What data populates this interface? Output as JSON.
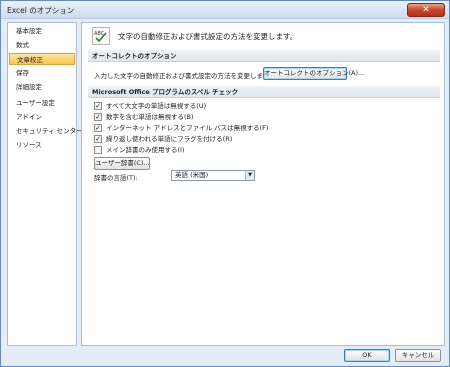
{
  "window": {
    "title": "Excel のオプション",
    "close_glyph": "✕"
  },
  "sidebar": {
    "items": [
      {
        "label": "基本設定",
        "active": false
      },
      {
        "label": "数式",
        "active": false
      },
      {
        "label": "文章校正",
        "active": true
      },
      {
        "label": "保存",
        "active": false
      },
      {
        "label": "詳細設定",
        "active": false
      },
      {
        "label": "ユーザー設定",
        "active": false
      },
      {
        "label": "アドイン",
        "active": false
      },
      {
        "label": "セキュリティ センター",
        "active": false
      },
      {
        "label": "リソース",
        "active": false
      }
    ]
  },
  "content": {
    "header_icon": "abc-spellcheck-icon",
    "header_text": "文字の自動修正および書式設定の方法を変更します。",
    "autocorrect": {
      "section_title": "オートコレクトのオプション",
      "description": "入力した文字の自動修正および書式設定の方法を変更します:",
      "button_label": "オートコレクトのオプション(A)..."
    },
    "spellcheck": {
      "section_title": "Microsoft Office プログラムのスペル チェック",
      "options": [
        {
          "label": "すべて大文字の単語は無視する(U)",
          "checked": true
        },
        {
          "label": "数字を含む単語は無視する(B)",
          "checked": true
        },
        {
          "label": "インターネット アドレスとファイル パスは無視する(F)",
          "checked": true
        },
        {
          "label": "繰り返し使われる単語にフラグを付ける(R)",
          "checked": true
        },
        {
          "label": "メイン辞書のみ使用する(I)",
          "checked": false
        }
      ],
      "custom_dict_button": "ユーザー辞書(C)...",
      "dictionary_language_label": "辞書の言語(T):",
      "dictionary_language_value": "英語 (米国)"
    }
  },
  "footer": {
    "ok_label": "OK",
    "cancel_label": "キャンセル"
  }
}
